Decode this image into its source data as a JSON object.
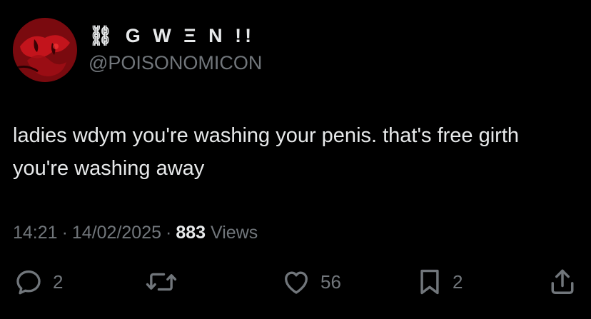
{
  "author": {
    "display_name": "⛓ G W Ξ N !!",
    "handle": "@POISONOMICON",
    "avatar_icon": "red-abstract-avatar"
  },
  "tweet": {
    "text": "ladies wdym you're washing your penis. that's free girth you're washing away"
  },
  "meta": {
    "time": "14:21",
    "separator": "·",
    "date": "14/02/2025",
    "views_count": "883",
    "views_label": "Views"
  },
  "actions": {
    "replies": "2",
    "retweets": "",
    "likes": "56",
    "bookmarks": "2"
  },
  "colors": {
    "background": "#000000",
    "text_primary": "#e7e9ea",
    "text_secondary": "#71767b",
    "avatar_red": "#c4121a"
  }
}
